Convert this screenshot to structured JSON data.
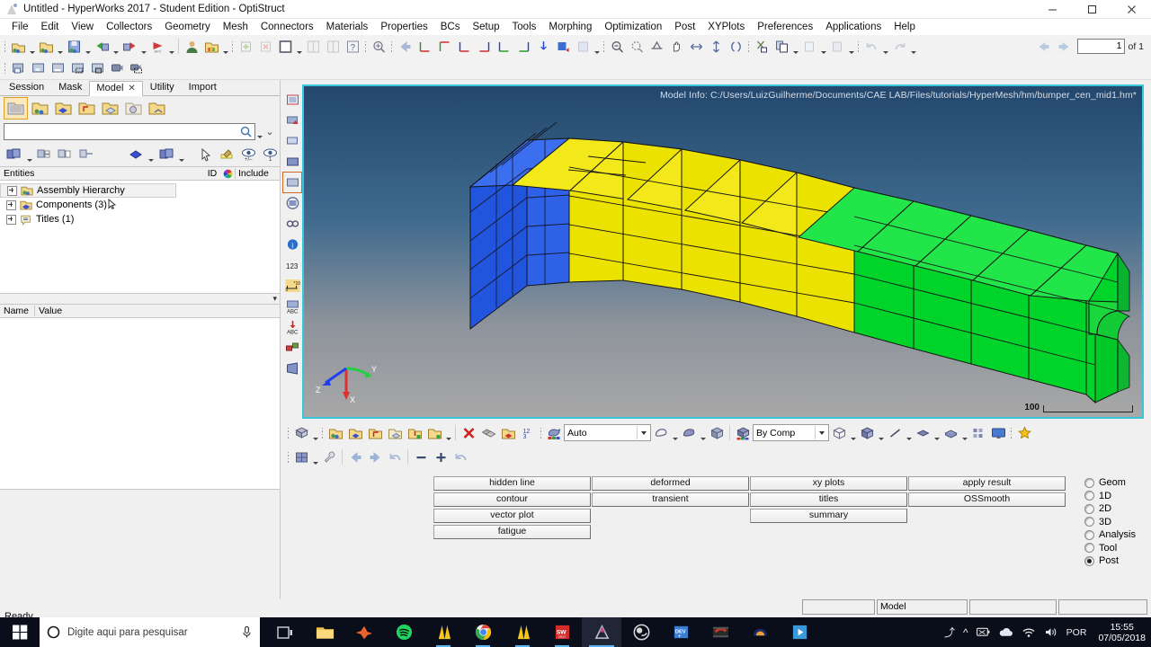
{
  "window": {
    "title": "Untitled - HyperWorks 2017 - Student Edition - OptiStruct",
    "minimize_label": "Minimize",
    "maximize_label": "Maximize",
    "close_label": "Close"
  },
  "menu": {
    "items": [
      "File",
      "Edit",
      "View",
      "Collectors",
      "Geometry",
      "Mesh",
      "Connectors",
      "Materials",
      "Properties",
      "BCs",
      "Setup",
      "Tools",
      "Morphing",
      "Optimization",
      "Post",
      "XYPlots",
      "Preferences",
      "Applications",
      "Help"
    ]
  },
  "toolbar": {
    "page_value": "1",
    "page_of": "of 1",
    "prev_page_label": "Previous page",
    "next_page_label": "Next page"
  },
  "browser": {
    "tabs": [
      {
        "label": "Session",
        "active": false
      },
      {
        "label": "Mask",
        "active": false
      },
      {
        "label": "Model",
        "active": true,
        "closable": true
      },
      {
        "label": "Utility",
        "active": false
      },
      {
        "label": "Import",
        "active": false
      }
    ],
    "search": {
      "value": "",
      "placeholder": ""
    },
    "columns": {
      "entities": "Entities",
      "id": "ID",
      "include": "Include"
    },
    "tree": [
      {
        "label": "Assembly Hierarchy",
        "icon": "assembly-icon",
        "highlighted": true
      },
      {
        "label": "Components (3)",
        "icon": "components-icon",
        "highlighted": false
      },
      {
        "label": "Titles (1)",
        "icon": "titles-icon",
        "highlighted": false
      }
    ],
    "name_value": {
      "name_header": "Name",
      "value_header": "Value"
    }
  },
  "graphics": {
    "model_info": "Model Info: C:/Users/LuizGuilherme/Documents/CAE LAB/Files/tutorials/HyperMesh/hm/bumper_cen_mid1.hm*",
    "scale_value": "100",
    "axis_x": "X",
    "axis_y": "Y",
    "axis_z": "Z",
    "mesh_colors": {
      "blue": "#2255dd",
      "yellow": "#ece200",
      "green": "#00d42a",
      "edge": "#1b1b1b"
    },
    "background_top": "#23476d",
    "background_bottom": "#a8a8a8",
    "border_color": "#38c6d9"
  },
  "view_toolbar": {
    "display_mode_label": "Auto",
    "color_mode_label": "By Comp"
  },
  "panel": {
    "columns": [
      [
        "hidden line",
        "contour",
        "vector plot",
        "fatigue"
      ],
      [
        "deformed",
        "transient"
      ],
      [
        "xy plots",
        "titles",
        "summary"
      ],
      [
        "apply result",
        "OSSmooth"
      ]
    ],
    "radios": [
      {
        "label": "Geom",
        "selected": false
      },
      {
        "label": "1D",
        "selected": false
      },
      {
        "label": "2D",
        "selected": false
      },
      {
        "label": "3D",
        "selected": false
      },
      {
        "label": "Analysis",
        "selected": false
      },
      {
        "label": "Tool",
        "selected": false
      },
      {
        "label": "Post",
        "selected": true
      }
    ]
  },
  "status": {
    "ready": "Ready",
    "field_left": "",
    "field_model": "Model",
    "field_mid": "",
    "field_right": ""
  },
  "taskbar": {
    "search_placeholder": "Digite aqui para pesquisar",
    "language": "POR",
    "time": "15:55",
    "date": "07/05/2018",
    "apps": [
      {
        "name": "task-view",
        "color": "#cfd3dc"
      },
      {
        "name": "file-explorer",
        "color": "#f2c14e"
      },
      {
        "name": "matlab",
        "color": "#e8622e"
      },
      {
        "name": "spotify",
        "color": "#1ed760"
      },
      {
        "name": "altair-hyperworks",
        "color": "#f5c518"
      },
      {
        "name": "google-chrome",
        "color": "#4285f4"
      },
      {
        "name": "altair-hypermesh",
        "color": "#f5c518"
      },
      {
        "name": "solidworks",
        "color": "#d42b2b"
      },
      {
        "name": "altair-active",
        "color": "#ffffff"
      },
      {
        "name": "obs-studio",
        "color": "#d8d8d8"
      },
      {
        "name": "dev-cpp",
        "color": "#3b7fd4"
      },
      {
        "name": "video-editor",
        "color": "#c0392b"
      },
      {
        "name": "audacity",
        "color": "#f0a030"
      },
      {
        "name": "media-player",
        "color": "#3a9ad9"
      }
    ]
  }
}
